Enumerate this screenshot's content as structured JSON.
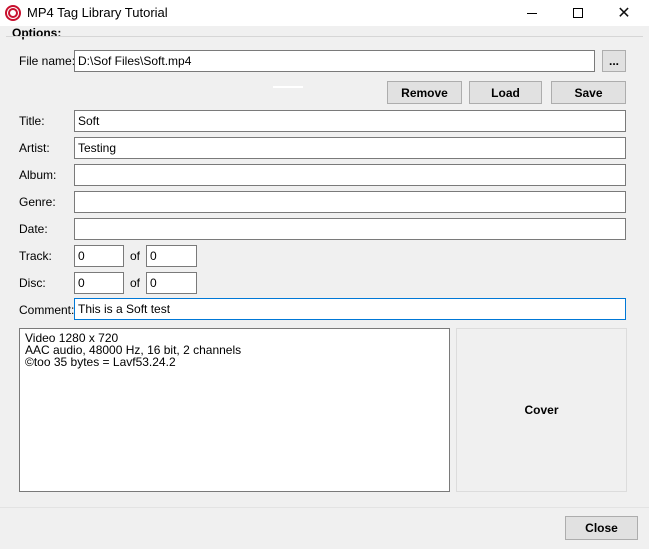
{
  "window": {
    "title": "MP4 Tag Library Tutorial",
    "close_glyph": "✕"
  },
  "options": {
    "group_label": "Options:",
    "file_name_label": "File name:",
    "file_name_value": "D:\\Sof Files\\Soft.mp4",
    "browse_label": "...",
    "remove_label": "Remove",
    "load_label": "Load",
    "save_label": "Save"
  },
  "tags": {
    "title_label": "Title:",
    "title_value": "Soft",
    "artist_label": "Artist:",
    "artist_value": "Testing",
    "album_label": "Album:",
    "album_value": "",
    "genre_label": "Genre:",
    "genre_value": "",
    "date_label": "Date:",
    "date_value": "",
    "track_label": "Track:",
    "track_value": "0",
    "track_of_label": "of",
    "track_total": "0",
    "disc_label": "Disc:",
    "disc_value": "0",
    "disc_of_label": "of",
    "disc_total": "0",
    "comment_label": "Comment:",
    "comment_value": "This is a Soft test"
  },
  "info": {
    "lines": [
      "Video 1280 x 720",
      "AAC audio, 48000 Hz, 16 bit, 2 channels",
      "©too 35 bytes = Lavf53.24.2"
    ]
  },
  "cover": {
    "label": "Cover"
  },
  "footer": {
    "close_label": "Close"
  }
}
